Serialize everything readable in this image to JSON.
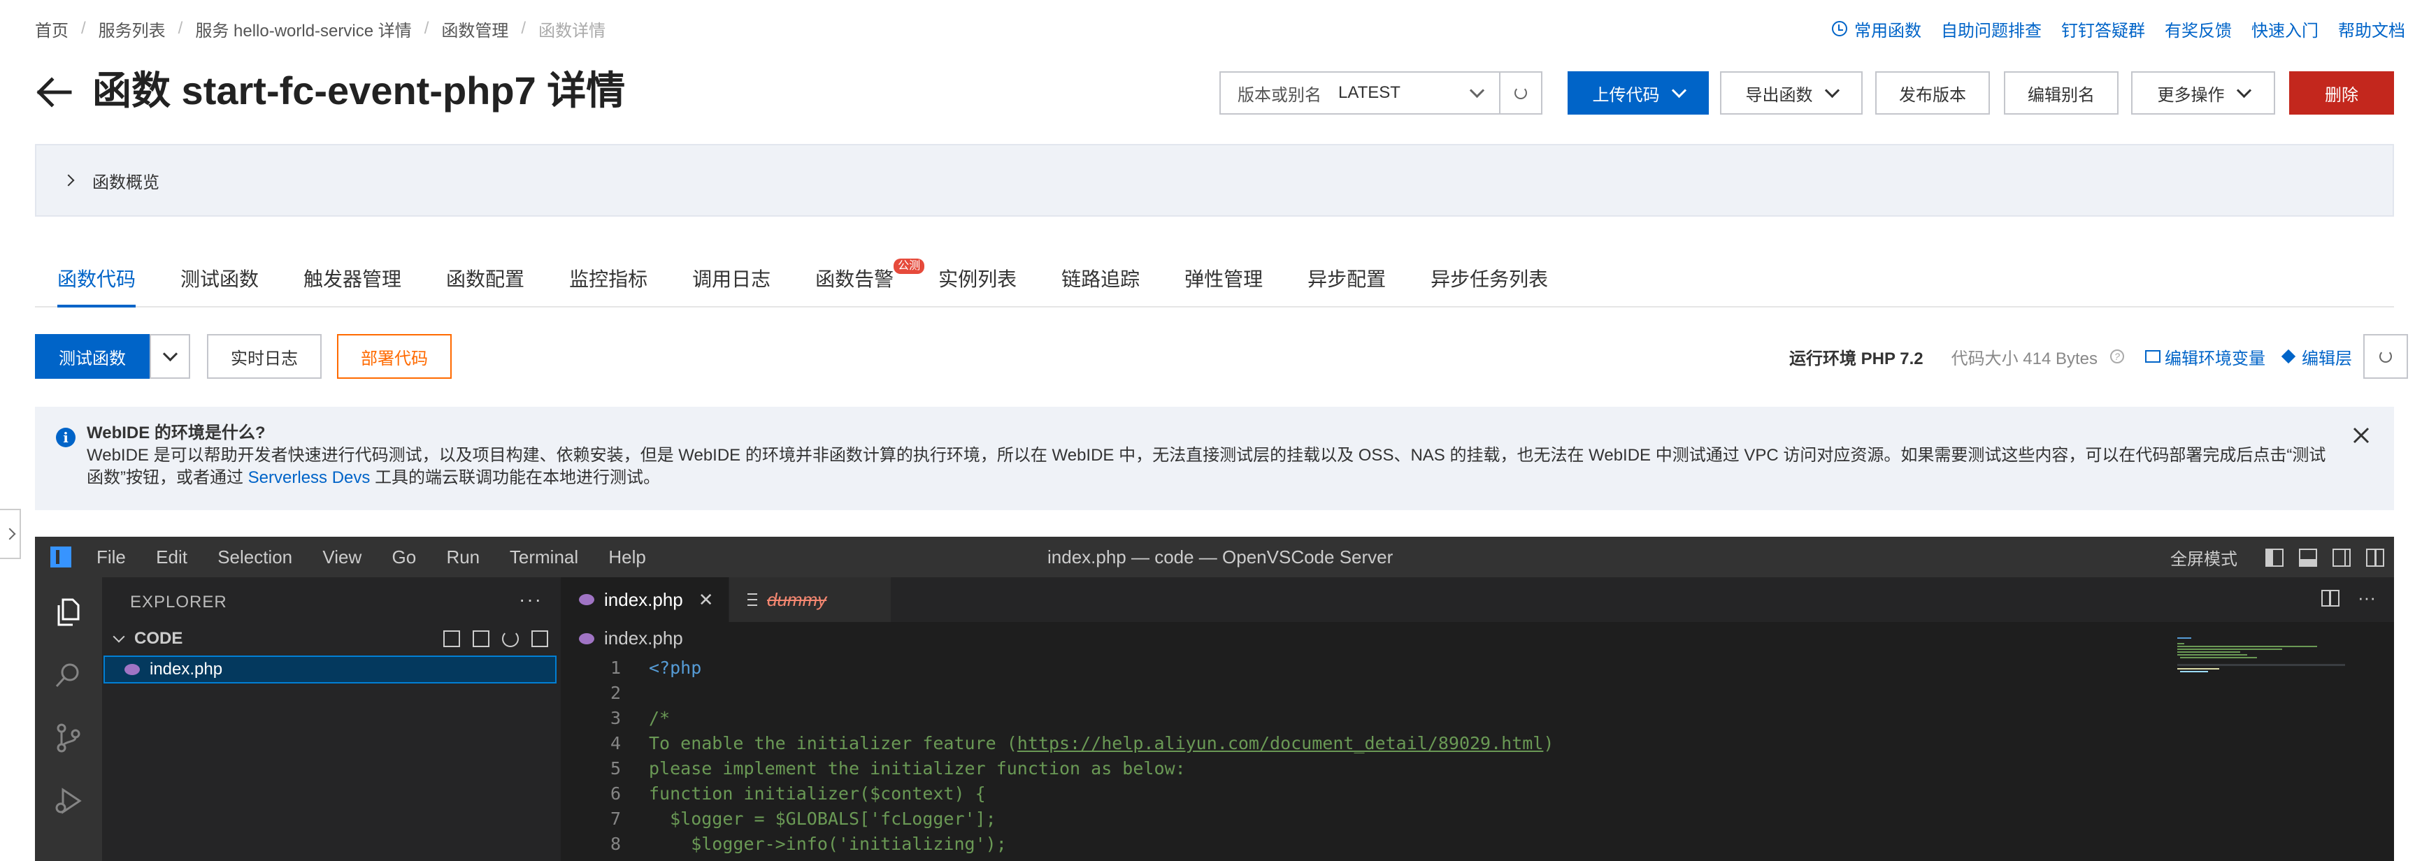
{
  "breadcrumb": {
    "items": [
      "首页",
      "服务列表",
      "服务 hello-world-service 详情",
      "函数管理"
    ],
    "current": "函数详情",
    "separator": "/"
  },
  "top_links": [
    "常用函数",
    "自助问题排查",
    "钉钉答疑群",
    "有奖反馈",
    "快速入门",
    "帮助文档"
  ],
  "page_title": "函数 start-fc-event-php7 详情",
  "version": {
    "label": "版本或别名",
    "value": "LATEST"
  },
  "header_buttons": {
    "upload": "上传代码",
    "export": "导出函数",
    "publish": "发布版本",
    "alias": "编辑别名",
    "more": "更多操作",
    "delete": "删除"
  },
  "overview_label": "函数概览",
  "tabs": [
    {
      "label": "函数代码",
      "active": true
    },
    {
      "label": "测试函数"
    },
    {
      "label": "触发器管理"
    },
    {
      "label": "函数配置"
    },
    {
      "label": "监控指标"
    },
    {
      "label": "调用日志"
    },
    {
      "label": "函数告警",
      "badge": "公测"
    },
    {
      "label": "实例列表"
    },
    {
      "label": "链路追踪"
    },
    {
      "label": "弹性管理"
    },
    {
      "label": "异步配置"
    },
    {
      "label": "异步任务列表"
    }
  ],
  "actions": {
    "test": "测试函数",
    "logs": "实时日志",
    "deploy": "部署代码"
  },
  "runtime": {
    "env": "运行环境 PHP 7.2",
    "code_size": "代码大小 414 Bytes",
    "edit_env": "编辑环境变量",
    "edit_layer": "编辑层"
  },
  "notice": {
    "title": "WebIDE 的环境是什么?",
    "body_1": "WebIDE 是可以帮助开发者快速进行代码测试，以及项目构建、依赖安装，但是 WebIDE 的环境并非函数计算的执行环境，所以在 WebIDE 中，无法直接测试层的挂载以及 OSS、NAS 的挂载，也无法在 WebIDE 中测试通过 VPC 访问对应资源。如果需要测试这些内容，可以在代码部署完成后点击“测试函",
    "body_2": "数”按钮，或者通过",
    "link": "Serverless Devs",
    "body_3": "工具的端云联调功能在本地进行测试。"
  },
  "vscode": {
    "menu": [
      "File",
      "Edit",
      "Selection",
      "View",
      "Go",
      "Run",
      "Terminal",
      "Help"
    ],
    "window_title": "index.php — code — OpenVSCode Server",
    "fullscreen": "全屏模式",
    "explorer_title": "EXPLORER",
    "folder": "CODE",
    "file": "index.php",
    "tabs": [
      {
        "name": "index.php",
        "active": true
      },
      {
        "name": "dummy",
        "deleted": true
      }
    ],
    "breadcrumb_file": "index.php",
    "code_lines": [
      {
        "n": "1",
        "text": "<?php"
      },
      {
        "n": "2",
        "text": ""
      },
      {
        "n": "3",
        "text": "/*"
      },
      {
        "n": "4",
        "pre": "To enable the initializer feature (",
        "url": "https://help.aliyun.com/document_detail/89029.html",
        "post": ")"
      },
      {
        "n": "5",
        "text": "please implement the initializer function as below:"
      },
      {
        "n": "6",
        "text": "function initializer($context) {"
      },
      {
        "n": "7",
        "text": "  $logger = $GLOBALS['fcLogger'];"
      },
      {
        "n": "8",
        "text": "    $logger->info('initializing');"
      }
    ]
  },
  "colors": {
    "primary": "#0064c8",
    "danger": "#c3271d",
    "deploy": "#ff6a00",
    "vscode_bg": "#1e1e1e",
    "comment": "#6a9955"
  }
}
